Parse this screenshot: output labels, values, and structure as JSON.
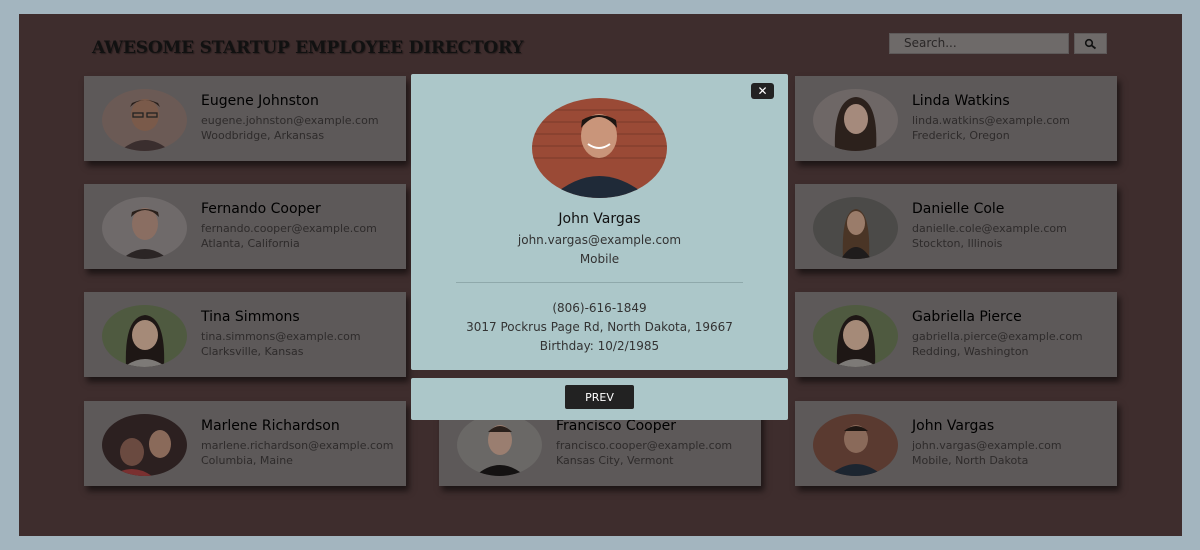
{
  "directory": {
    "title": "AWESOME STARTUP EMPLOYEE DIRECTORY",
    "search_placeholder": "Search...",
    "search_icon": "search-icon"
  },
  "employees": [
    {
      "name": "Eugene Johnston",
      "email": "eugene.johnston@example.com",
      "location": "Woodbridge, Arkansas"
    },
    {
      "name": "Linda Watkins",
      "email": "linda.watkins@example.com",
      "location": "Frederick, Oregon"
    },
    {
      "name": "Fernando Cooper",
      "email": "fernando.cooper@example.com",
      "location": "Atlanta, California"
    },
    {
      "name": "Danielle Cole",
      "email": "danielle.cole@example.com",
      "location": "Stockton, Illinois"
    },
    {
      "name": "Tina Simmons",
      "email": "tina.simmons@example.com",
      "location": "Clarksville, Kansas"
    },
    {
      "name": "Gabriella Pierce",
      "email": "gabriella.pierce@example.com",
      "location": "Redding, Washington"
    },
    {
      "name": "Marlene Richardson",
      "email": "marlene.richardson@example.com",
      "location": "Columbia, Maine"
    },
    {
      "name": "Francisco Cooper",
      "email": "francisco.cooper@example.com",
      "location": "Kansas City, Vermont"
    },
    {
      "name": "John Vargas",
      "email": "john.vargas@example.com",
      "location": "Mobile, North Dakota"
    }
  ],
  "modal": {
    "close_label": "✕",
    "name": "John Vargas",
    "email": "john.vargas@example.com",
    "city": "Mobile",
    "phone": "(806)-616-1849",
    "address": "3017 Pockrus Page Rd, North Dakota, 19667",
    "birthday": "Birthday: 10/2/1985",
    "prev_label": "PREV"
  },
  "colors": {
    "backdrop": "#3e2d2d",
    "card": "#5d5959",
    "modal": "#acc7c9",
    "button": "#222222"
  }
}
